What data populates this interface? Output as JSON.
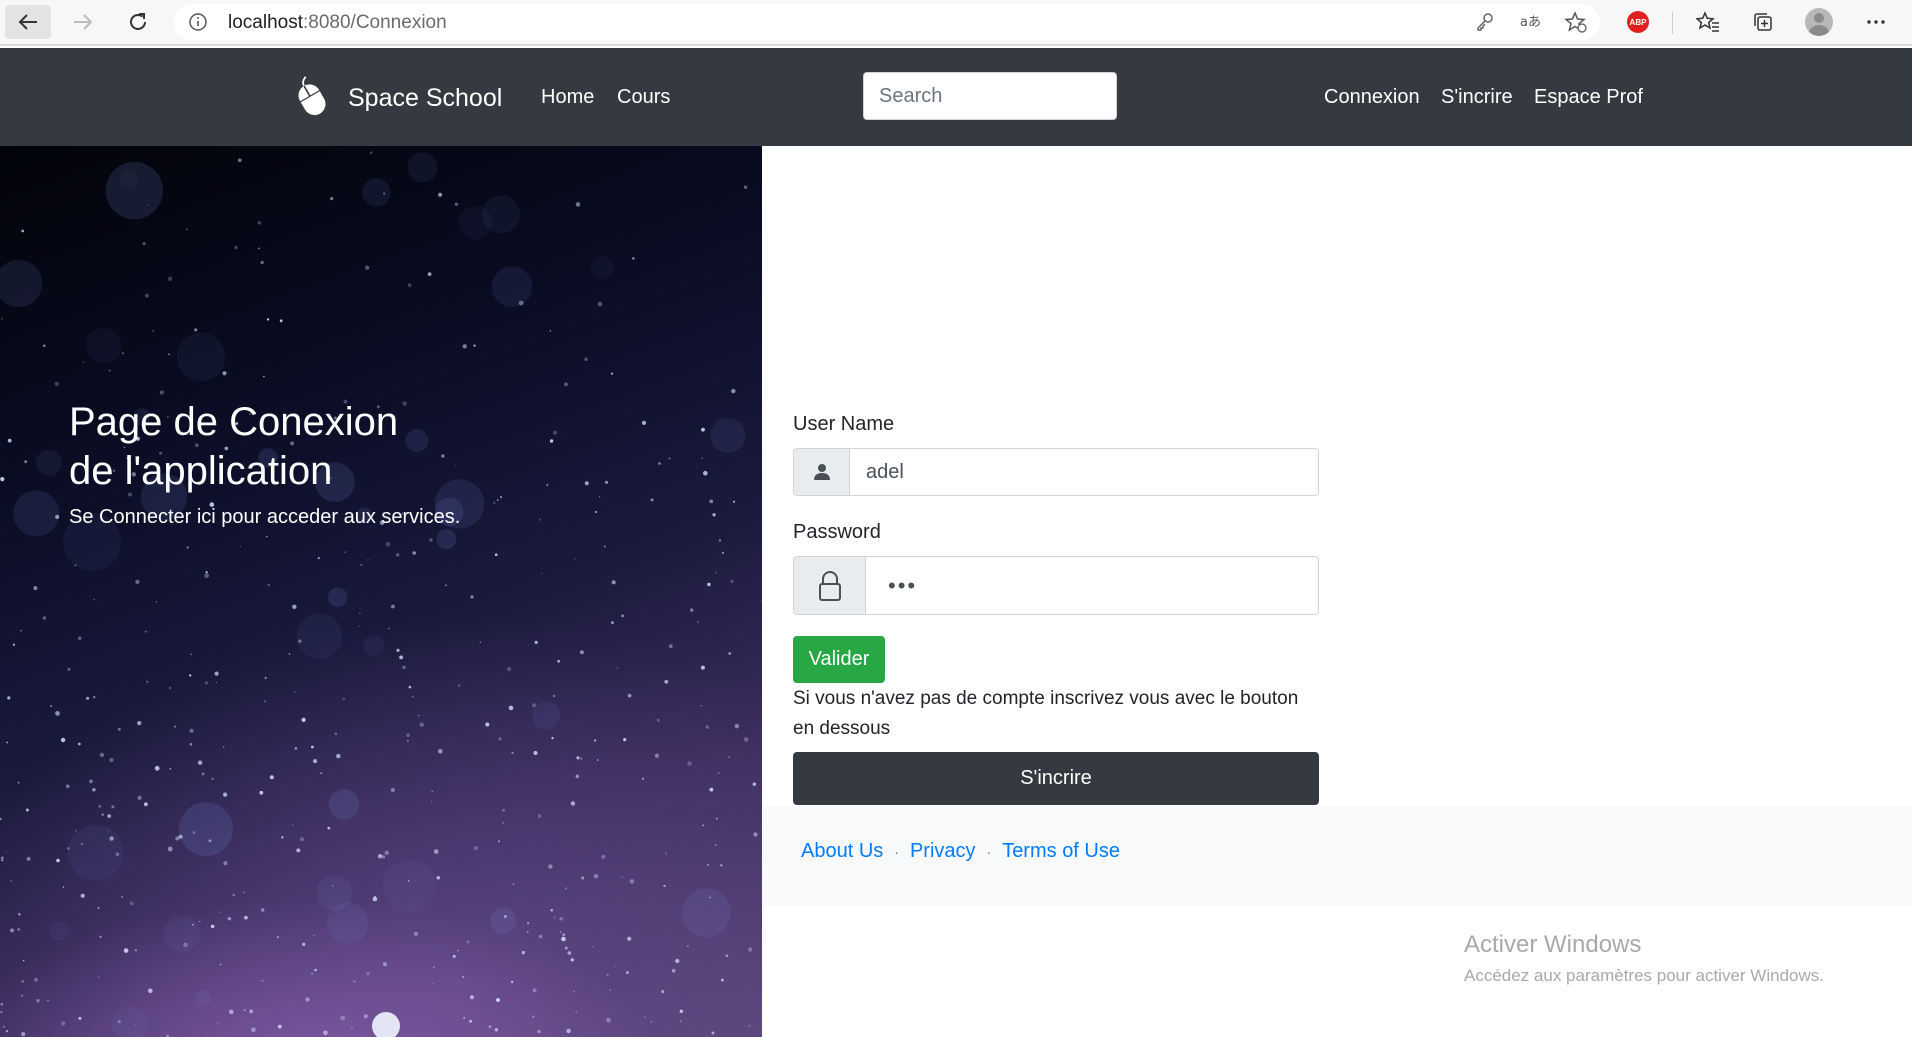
{
  "browser": {
    "url_host": "localhost",
    "url_path": ":8080/Connexion",
    "icons": [
      "back-arrow-icon",
      "forward-arrow-icon",
      "refresh-icon",
      "info-icon",
      "key-icon",
      "read-aloud-icon",
      "add-favorite-icon",
      "adblock-plus-icon",
      "favorites-icon",
      "collections-icon",
      "profile-icon",
      "more-icon"
    ],
    "abp_label": "ABP"
  },
  "navbar": {
    "brand": "Space School",
    "links": [
      "Home",
      "Cours"
    ],
    "search_placeholder": "Search",
    "right_links": [
      "Connexion",
      "S'incrire",
      "Espace Prof"
    ]
  },
  "hero": {
    "title_line1": "Page de Conexion",
    "title_line2": "de l'application",
    "subtitle": "Se Connecter ici pour acceder aux services."
  },
  "form": {
    "username_label": "User Name",
    "username_value": "adel",
    "password_label": "Password",
    "password_masked": "•••",
    "submit_label": "Valider",
    "hint": "Si vous n'avez pas de compte inscrivez vous avec le bouton en dessous",
    "signup_label": "S'incrire"
  },
  "footer": {
    "links": [
      "About Us",
      "Privacy",
      "Terms of Use"
    ],
    "separator": "·"
  },
  "watermark": {
    "title": "Activer Windows",
    "subtitle": "Accédez aux paramètres pour activer Windows."
  },
  "colors": {
    "navbar": "#343a40",
    "success": "#28a745",
    "link": "#007bff",
    "footer_bg": "#f8f9fa"
  }
}
